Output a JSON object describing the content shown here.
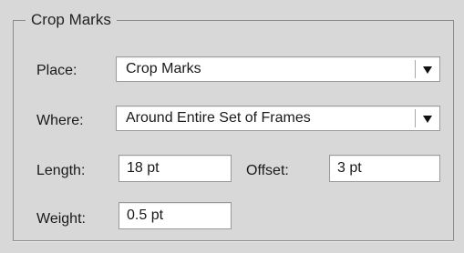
{
  "group": {
    "title": "Crop Marks"
  },
  "place": {
    "label": "Place:",
    "selected": "Crop Marks"
  },
  "where": {
    "label": "Where:",
    "selected": "Around Entire Set of Frames"
  },
  "length": {
    "label": "Length:",
    "value": "18 pt"
  },
  "offset": {
    "label": "Offset:",
    "value": "3 pt"
  },
  "weight": {
    "label": "Weight:",
    "value": "0.5 pt"
  },
  "icons": {
    "dropdown": "chevron-down-icon"
  }
}
